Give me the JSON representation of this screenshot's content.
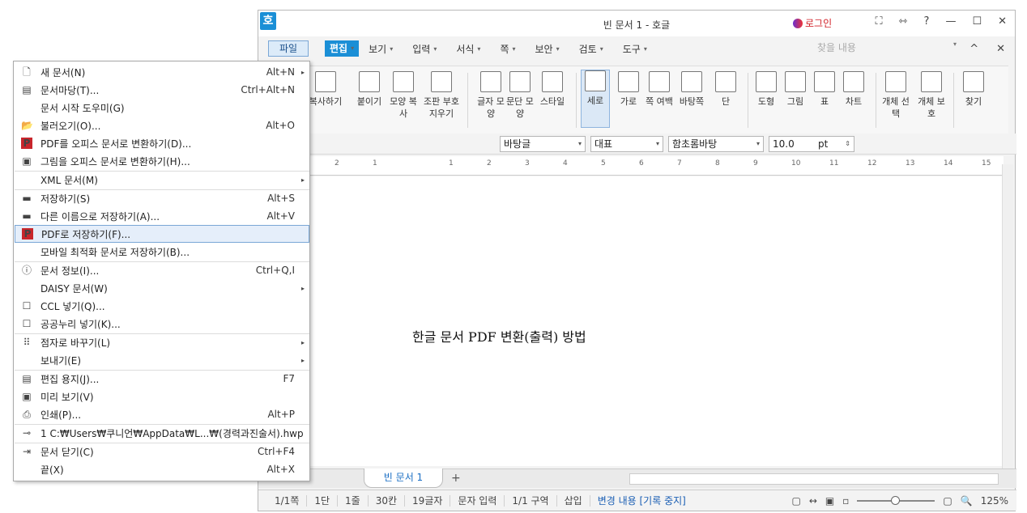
{
  "window": {
    "title": "빈 문서 1 - 호글",
    "logo_char": "호",
    "login": "로그인",
    "tb_buttons": [
      "⛶",
      "⇿",
      "?",
      "—",
      "☐",
      "✕"
    ]
  },
  "menubar": {
    "file": "파일",
    "edit": "편집",
    "items": [
      "보기",
      "입력",
      "서식",
      "쪽",
      "보안",
      "검토",
      "도구"
    ],
    "search_placeholder": "찾을 내용",
    "right": [
      "^",
      "✕"
    ]
  },
  "ribbon": {
    "buttons": [
      "복사하기",
      "붙이기",
      "모양 복사",
      "조판 부호 지우기",
      "글자 모양",
      "문단 모양",
      "스타일",
      "세로",
      "가로",
      "쪽 여백",
      "바탕쪽",
      "단",
      "도형",
      "그림",
      "표",
      "차트",
      "개체 선택",
      "개체 보호",
      "찾기"
    ]
  },
  "format": {
    "style": "바탕글",
    "lang": "대표",
    "font": "함초롬바탕",
    "size": "10.0",
    "unit": "pt"
  },
  "ruler": {
    "ticks": [
      "2",
      "1",
      "1",
      "2",
      "3",
      "4",
      "5",
      "6",
      "7",
      "8",
      "9",
      "10",
      "11",
      "12",
      "13",
      "14",
      "15"
    ]
  },
  "document": {
    "text": "한글 문서 PDF 변환(출력) 방법"
  },
  "tabs": {
    "doc_tab": "빈 문서 1",
    "add": "+"
  },
  "status": {
    "items": [
      "1/1쪽",
      "1단",
      "1줄",
      "30칸",
      "19글자",
      "문자 입력",
      "1/1 구역",
      "삽입"
    ],
    "track": "변경 내용 [기록 중지]",
    "zoom": "125%"
  },
  "file_menu": {
    "items": [
      {
        "icon": "new-doc-icon",
        "glyph": "🗋",
        "label": "새 문서(N)",
        "shortcut": "Alt+N",
        "sub": true
      },
      {
        "icon": "template-icon",
        "glyph": "▤",
        "label": "문서마당(T)...",
        "shortcut": "Ctrl+Alt+N",
        "sub": false
      },
      {
        "icon": "",
        "glyph": "",
        "label": "문서 시작 도우미(G)",
        "shortcut": "",
        "sub": false
      },
      {
        "icon": "open-folder-icon",
        "glyph": "📂",
        "label": "불러오기(O)...",
        "shortcut": "Alt+O",
        "sub": false
      },
      {
        "icon": "pdf-convert-icon",
        "glyph": "P",
        "label": "PDF를 오피스 문서로 변환하기(D)...",
        "shortcut": "",
        "sub": false
      },
      {
        "icon": "image-convert-icon",
        "glyph": "▣",
        "label": "그림을 오피스 문서로 변환하기(H)...",
        "shortcut": "",
        "sub": false
      },
      {
        "icon": "",
        "glyph": "",
        "label": "XML 문서(M)",
        "shortcut": "",
        "sub": true
      },
      {
        "icon": "save-icon",
        "glyph": "▬",
        "label": "저장하기(S)",
        "shortcut": "Alt+S",
        "sub": false
      },
      {
        "icon": "save-as-icon",
        "glyph": "▬",
        "label": "다른 이름으로 저장하기(A)...",
        "shortcut": "Alt+V",
        "sub": false
      },
      {
        "icon": "save-pdf-icon",
        "glyph": "P",
        "label": "PDF로 저장하기(F)...",
        "shortcut": "",
        "sub": false
      },
      {
        "icon": "",
        "glyph": "",
        "label": "모바일 최적화 문서로 저장하기(B)...",
        "shortcut": "",
        "sub": false
      },
      {
        "icon": "info-icon",
        "glyph": "ⓘ",
        "label": "문서 정보(I)...",
        "shortcut": "Ctrl+Q,I",
        "sub": false
      },
      {
        "icon": "",
        "glyph": "",
        "label": "DAISY 문서(W)",
        "shortcut": "",
        "sub": true
      },
      {
        "icon": "ccl-icon",
        "glyph": "☐",
        "label": "CCL 넣기(Q)...",
        "shortcut": "",
        "sub": false
      },
      {
        "icon": "open-license-icon",
        "glyph": "☐",
        "label": "공공누리 넣기(K)...",
        "shortcut": "",
        "sub": false
      },
      {
        "icon": "braille-icon",
        "glyph": "⠿",
        "label": "점자로 바꾸기(L)",
        "shortcut": "",
        "sub": true
      },
      {
        "icon": "",
        "glyph": "",
        "label": "보내기(E)",
        "shortcut": "",
        "sub": true
      },
      {
        "icon": "page-setup-icon",
        "glyph": "▤",
        "label": "편집 용지(J)...",
        "shortcut": "F7",
        "sub": false
      },
      {
        "icon": "preview-icon",
        "glyph": "▣",
        "label": "미리 보기(V)",
        "shortcut": "",
        "sub": false
      },
      {
        "icon": "print-icon",
        "glyph": "⎙",
        "label": "인쇄(P)...",
        "shortcut": "Alt+P",
        "sub": false
      },
      {
        "icon": "recent-file-icon",
        "glyph": "⊸",
        "label": "1 C:₩Users₩쿠니언₩AppData₩L...₩(경력과진술서).hwp",
        "shortcut": "",
        "sub": false
      },
      {
        "icon": "close-doc-icon",
        "glyph": "⇥",
        "label": "문서 닫기(C)",
        "shortcut": "Ctrl+F4",
        "sub": false
      },
      {
        "icon": "",
        "glyph": "",
        "label": "끝(X)",
        "shortcut": "Alt+X",
        "sub": false
      }
    ]
  }
}
